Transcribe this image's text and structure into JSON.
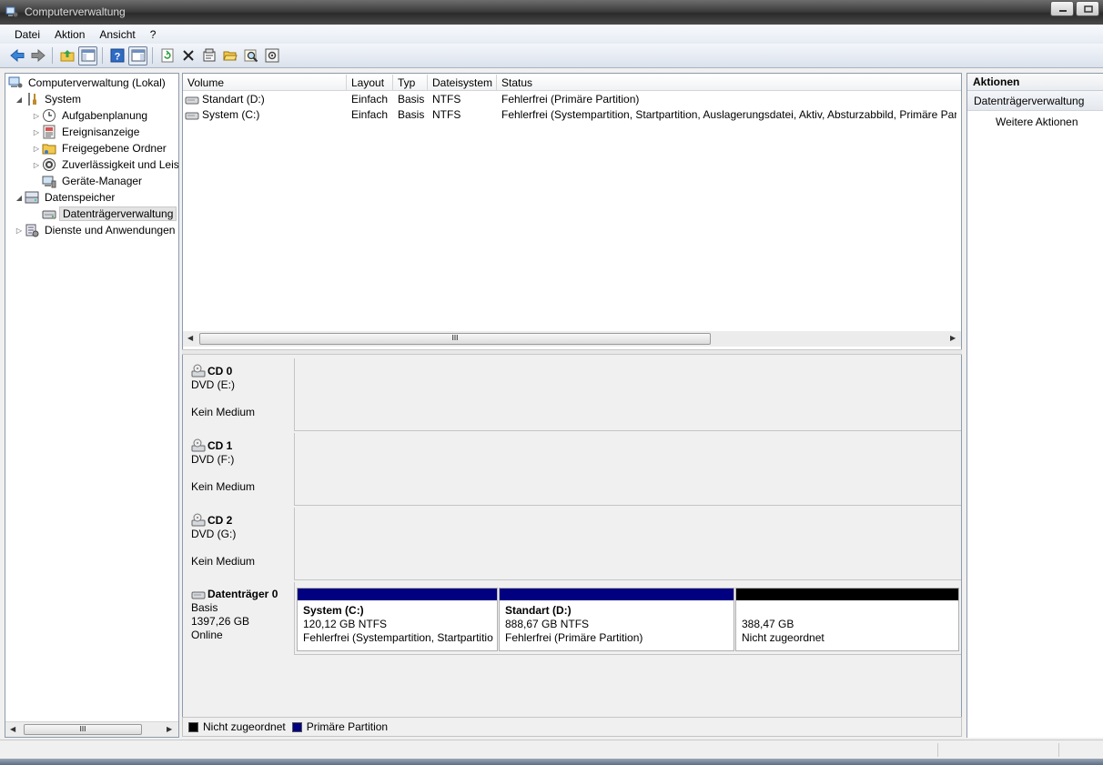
{
  "window": {
    "title": "Computerverwaltung"
  },
  "menubar": [
    "Datei",
    "Aktion",
    "Ansicht",
    "?"
  ],
  "toolbar": {
    "buttons": [
      "back-icon",
      "forward-icon",
      "up-folder-icon",
      "show-hide-console-tree-icon",
      "help-icon",
      "show-hide-action-pane-icon",
      "refresh-icon",
      "delete-icon",
      "properties-icon",
      "open-folder-icon",
      "search-icon",
      "settings-icon"
    ]
  },
  "tree": {
    "root": "Computerverwaltung (Lokal)",
    "system": "System",
    "aufgaben": "Aufgabenplanung",
    "ereignis": "Ereignisanzeige",
    "freigaben": "Freigegebene Ordner",
    "zuverl": "Zuverlässigkeit und Leis",
    "geraete": "Geräte-Manager",
    "datenspeicher": "Datenspeicher",
    "dtv": "Datenträgerverwaltung",
    "dienste": "Dienste und Anwendungen",
    "scroll_thumb": "III"
  },
  "volumes": {
    "columns": [
      "Volume",
      "Layout",
      "Typ",
      "Dateisystem",
      "Status"
    ],
    "rows": [
      [
        "Standart (D:)",
        "Einfach",
        "Basis",
        "NTFS",
        "Fehlerfrei (Primäre Partition)"
      ],
      [
        "System (C:)",
        "Einfach",
        "Basis",
        "NTFS",
        "Fehlerfrei (Systempartition, Startpartition, Auslagerungsdatei, Aktiv, Absturzabbild, Primäre Parti"
      ]
    ],
    "scroll_thumb": "III"
  },
  "disks": [
    {
      "name": "CD 0",
      "line1": "DVD (E:)",
      "line2": "",
      "line3": "Kein Medium"
    },
    {
      "name": "CD 1",
      "line1": "DVD (F:)",
      "line2": "",
      "line3": "Kein Medium"
    },
    {
      "name": "CD 2",
      "line1": "DVD (G:)",
      "line2": "",
      "line3": "Kein Medium"
    },
    {
      "name": "Datenträger 0",
      "line1": "Basis",
      "line2": "1397,26 GB",
      "line3": "Online"
    }
  ],
  "partitions": [
    {
      "name": "System  (C:)",
      "size": "120,12 GB NTFS",
      "status": "Fehlerfrei (Systempartition, Startpartitio",
      "color": "#000080"
    },
    {
      "name": "Standart  (D:)",
      "size": "888,67 GB NTFS",
      "status": "Fehlerfrei (Primäre Partition)",
      "color": "#000080"
    },
    {
      "name": "",
      "size": "388,47 GB",
      "status": "Nicht zugeordnet",
      "color": "#000000"
    }
  ],
  "legend": [
    {
      "label": "Nicht zugeordnet",
      "color": "#000000"
    },
    {
      "label": "Primäre Partition",
      "color": "#000080"
    }
  ],
  "actions": {
    "title": "Aktionen",
    "section": "Datenträgerverwaltung",
    "more": "Weitere Aktionen"
  }
}
